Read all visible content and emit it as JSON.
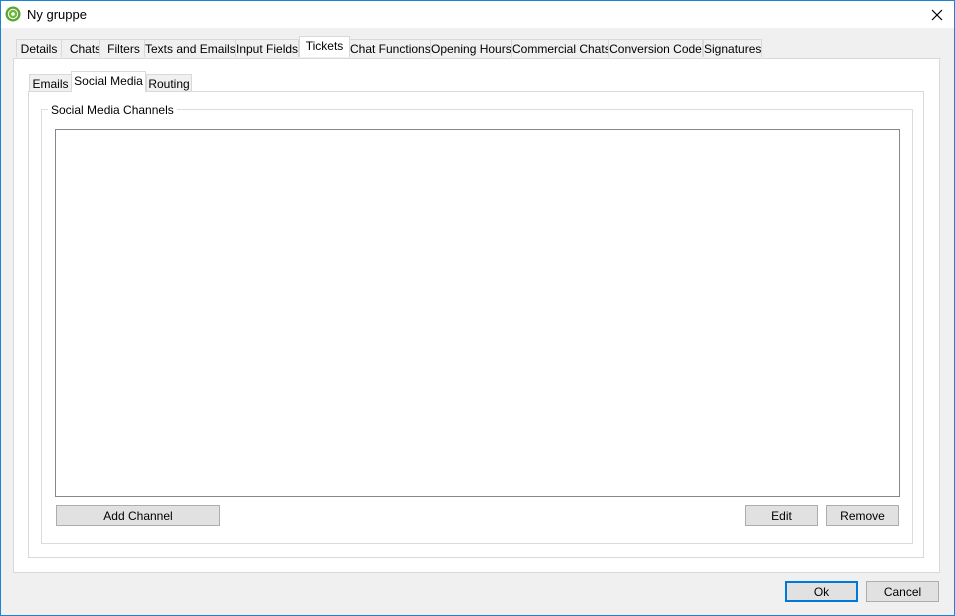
{
  "window": {
    "title": "Ny gruppe",
    "icon": "gear-icon",
    "accent_color": "#0078d7"
  },
  "tabs": [
    {
      "label": "Details"
    },
    {
      "label": "Chats"
    },
    {
      "label": "Filters"
    },
    {
      "label": "Texts and Emails"
    },
    {
      "label": "Input Fields"
    },
    {
      "label": "Tickets"
    },
    {
      "label": "Chat Functions"
    },
    {
      "label": "Opening Hours"
    },
    {
      "label": "Commercial Chats"
    },
    {
      "label": "Conversion Code"
    },
    {
      "label": "Signatures"
    }
  ],
  "subtabs": [
    {
      "label": "Emails"
    },
    {
      "label": "Social Media"
    },
    {
      "label": "Routing"
    }
  ],
  "group": {
    "title": "Social Media Channels",
    "add_label": "Add Channel",
    "edit_label": "Edit",
    "remove_label": "Remove"
  },
  "footer": {
    "ok_label": "Ok",
    "cancel_label": "Cancel"
  }
}
